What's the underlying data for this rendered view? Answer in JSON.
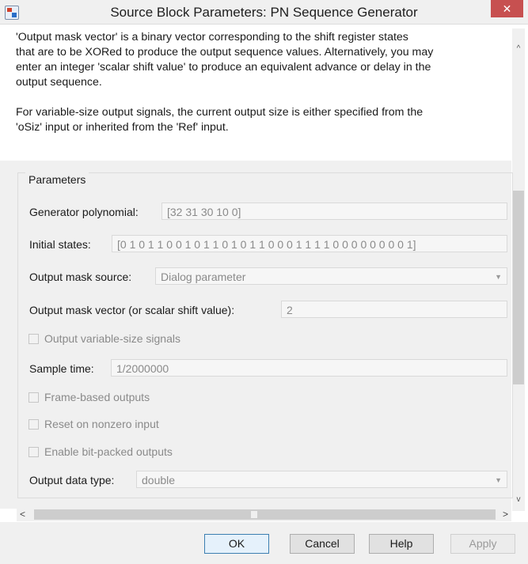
{
  "window": {
    "title": "Source Block Parameters: PN Sequence Generator",
    "close_glyph": "✕"
  },
  "description": {
    "lines1": [
      "'Output mask vector' is a binary vector corresponding to the shift register states",
      "that are to be XORed to produce the output sequence values. Alternatively, you may",
      "enter an integer 'scalar shift value' to produce an equivalent advance or delay in the",
      "output sequence."
    ],
    "lines2": [
      "For variable-size output signals, the current output size is either specified from the",
      "'oSiz' input or inherited from the 'Ref' input."
    ]
  },
  "parameters": {
    "group_label": "Parameters",
    "generator_polynomial": {
      "label": "Generator polynomial:",
      "value": "[32 31 30 10 0]"
    },
    "initial_states": {
      "label": "Initial states:",
      "value": "[0 1 0 1 1 0 0 1 0 1 1 0 1 0 1 1 0 0 0 1 1 1 1 0 0 0 0 0 0 0 0 1]"
    },
    "output_mask_source": {
      "label": "Output mask source:",
      "value": "Dialog parameter"
    },
    "output_mask_vector": {
      "label": "Output mask vector (or scalar shift value):",
      "value": "2"
    },
    "output_variable_size": {
      "label": "Output variable-size signals",
      "checked": false
    },
    "sample_time": {
      "label": "Sample time:",
      "value": "1/2000000"
    },
    "frame_based": {
      "label": "Frame-based outputs",
      "checked": false
    },
    "reset_nonzero": {
      "label": "Reset on nonzero input",
      "checked": false
    },
    "bit_packed": {
      "label": "Enable bit-packed outputs",
      "checked": false
    },
    "output_data_type": {
      "label": "Output data type:",
      "value": "double"
    }
  },
  "buttons": {
    "ok": "OK",
    "cancel": "Cancel",
    "help": "Help",
    "apply": "Apply"
  },
  "scroll": {
    "up": "^",
    "down": "v",
    "left": "<",
    "right": ">"
  }
}
